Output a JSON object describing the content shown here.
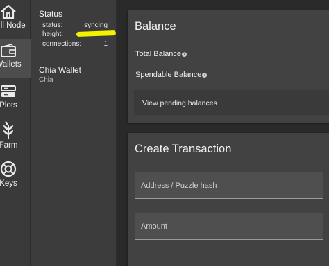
{
  "nav": {
    "items": [
      {
        "label": "Full Node",
        "icon": "home-icon"
      },
      {
        "label": "Wallets",
        "icon": "wallet-icon"
      },
      {
        "label": "Plots",
        "icon": "hard-drive-icon"
      },
      {
        "label": "Farm",
        "icon": "plant-icon"
      },
      {
        "label": "Keys",
        "icon": "lifebuoy-icon"
      }
    ],
    "active_index": 1
  },
  "status": {
    "title": "Status",
    "status_label": "status:",
    "status_value": "syncing",
    "height_label": "height:",
    "connections_label": "connections:",
    "connections_value": "1",
    "highlight_color": "#f3f300"
  },
  "wallet": {
    "name": "Chia Wallet",
    "subtitle": "Chia"
  },
  "balance": {
    "title": "Balance",
    "total_label": "Total Balance",
    "spendable_label": "Spendable Balance",
    "pending_button": "View pending balances"
  },
  "transaction": {
    "title": "Create Transaction",
    "address_placeholder": "Address / Puzzle hash",
    "amount_placeholder": "Amount"
  },
  "colors": {
    "background": "#2a2a2a",
    "rail": "#3a3a3a",
    "rail_active": "#4d4d4d",
    "panel": "#3c3c3c",
    "card": "#424242"
  }
}
